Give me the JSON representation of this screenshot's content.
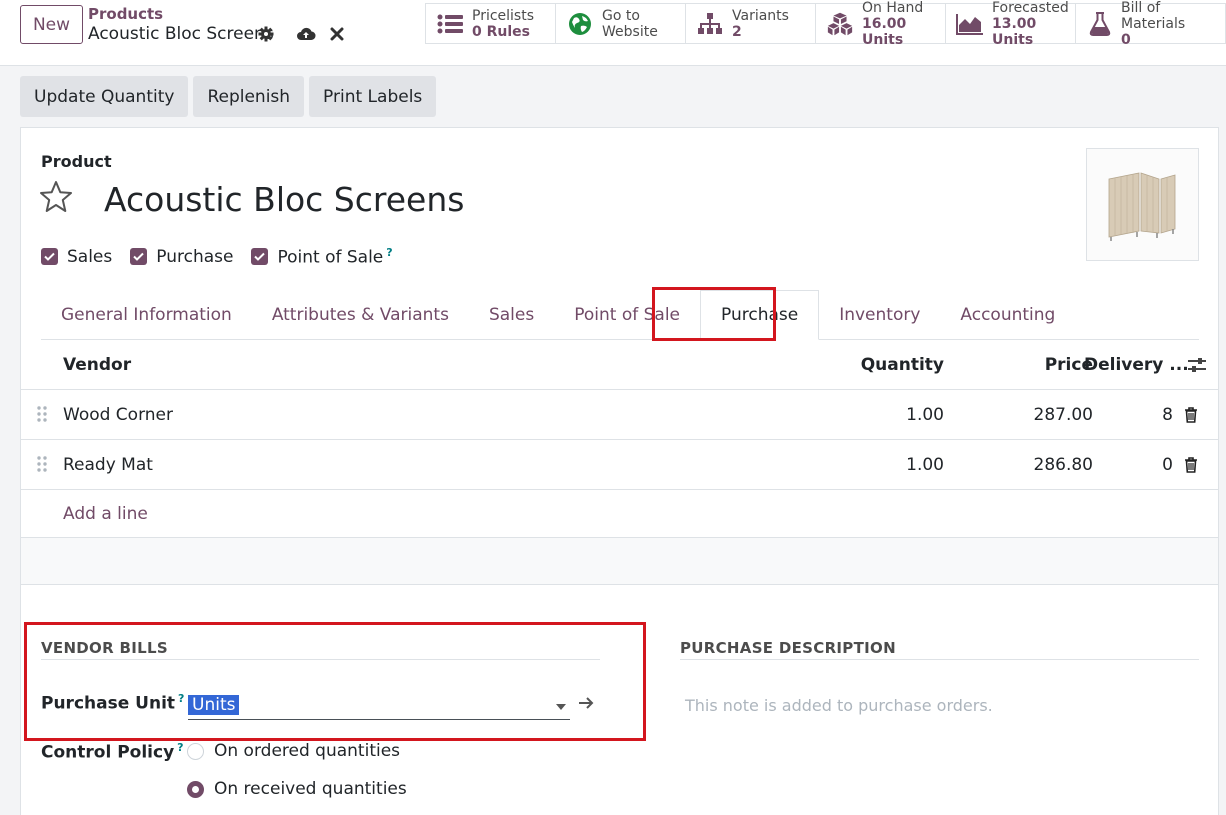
{
  "header": {
    "new_label": "New",
    "breadcrumb_parent": "Products",
    "breadcrumb_current": "Acoustic Bloc Screens"
  },
  "smart_buttons": [
    {
      "label": "Pricelists",
      "value": "0  Rules",
      "icon": "list-icon"
    },
    {
      "label": "Go to",
      "value": "Website",
      "icon": "globe-icon"
    },
    {
      "label": "Variants",
      "value": "2",
      "icon": "sitemap-icon"
    },
    {
      "label": "On Hand",
      "value": "16.00 Units",
      "icon": "cubes-icon"
    },
    {
      "label": "Forecasted",
      "value": "13.00 Units",
      "icon": "area-chart-icon"
    },
    {
      "label": "Bill of Materials",
      "value": "0",
      "icon": "flask-icon"
    }
  ],
  "actions": {
    "update_quantity": "Update Quantity",
    "replenish": "Replenish",
    "print_labels": "Print Labels"
  },
  "product": {
    "label": "Product",
    "name": "Acoustic Bloc Screens",
    "checks": {
      "sales": "Sales",
      "purchase": "Purchase",
      "pos": "Point of Sale",
      "pos_help": "?"
    }
  },
  "tabs": [
    {
      "label": "General Information",
      "active": false
    },
    {
      "label": "Attributes & Variants",
      "active": false
    },
    {
      "label": "Sales",
      "active": false
    },
    {
      "label": "Point of Sale",
      "active": false
    },
    {
      "label": "Purchase",
      "active": true
    },
    {
      "label": "Inventory",
      "active": false
    },
    {
      "label": "Accounting",
      "active": false
    }
  ],
  "vendor_table": {
    "headers": {
      "vendor": "Vendor",
      "quantity": "Quantity",
      "price": "Price",
      "delivery": "Delivery ..."
    },
    "rows": [
      {
        "vendor": "Wood Corner",
        "quantity": "1.00",
        "price": "287.00",
        "delivery": "8"
      },
      {
        "vendor": "Ready Mat",
        "quantity": "1.00",
        "price": "286.80",
        "delivery": "0"
      }
    ],
    "add_line": "Add a line"
  },
  "vendor_bills": {
    "title": "VENDOR BILLS",
    "purchase_unit_label": "Purchase Unit",
    "purchase_unit_help": "?",
    "purchase_unit_value": "Units",
    "control_policy_label": "Control Policy",
    "control_policy_help": "?",
    "policies": [
      {
        "label": "On ordered quantities",
        "selected": false
      },
      {
        "label": "On received quantities",
        "selected": true
      }
    ]
  },
  "purchase_description": {
    "title": "PURCHASE DESCRIPTION",
    "placeholder": "This note is added to purchase orders."
  },
  "colors": {
    "brand": "#714B67",
    "highlight": "#d3161e",
    "selection": "#3367d6"
  }
}
